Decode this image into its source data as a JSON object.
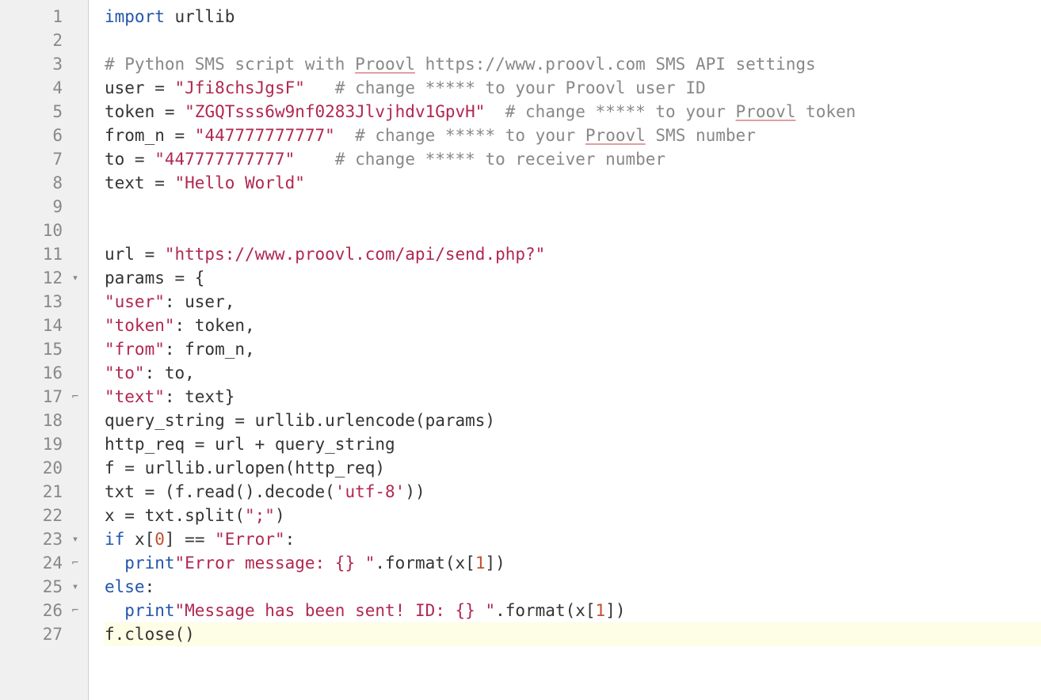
{
  "code": {
    "lines": [
      {
        "n": 1,
        "fold": "",
        "tokens": [
          [
            "kw",
            "import"
          ],
          [
            "",
            " urllib"
          ]
        ]
      },
      {
        "n": 2,
        "fold": "",
        "tokens": []
      },
      {
        "n": 3,
        "fold": "",
        "tokens": [
          [
            "cmt",
            "# Python SMS script with "
          ],
          [
            "cmt typo",
            "Proovl"
          ],
          [
            "cmt",
            " https://www.proovl.com SMS API settings"
          ]
        ]
      },
      {
        "n": 4,
        "fold": "",
        "tokens": [
          [
            "",
            "user = "
          ],
          [
            "str",
            "\"Jfi8chsJgsF\""
          ],
          [
            "",
            "   "
          ],
          [
            "cmt",
            "# change ***** to your Proovl user ID"
          ]
        ]
      },
      {
        "n": 5,
        "fold": "",
        "tokens": [
          [
            "",
            "token = "
          ],
          [
            "str",
            "\"ZGQTsss6w9nf0283Jlvjhdv1GpvH\""
          ],
          [
            "",
            "  "
          ],
          [
            "cmt",
            "# change ***** to your "
          ],
          [
            "cmt typo",
            "Proovl"
          ],
          [
            "cmt",
            " token"
          ]
        ]
      },
      {
        "n": 6,
        "fold": "",
        "tokens": [
          [
            "",
            "from_n = "
          ],
          [
            "str",
            "\"447777777777\""
          ],
          [
            "",
            "  "
          ],
          [
            "cmt",
            "# change ***** to your "
          ],
          [
            "cmt typo",
            "Proovl"
          ],
          [
            "cmt",
            " SMS number"
          ]
        ]
      },
      {
        "n": 7,
        "fold": "",
        "tokens": [
          [
            "",
            "to = "
          ],
          [
            "str",
            "\"447777777777\""
          ],
          [
            "",
            "    "
          ],
          [
            "cmt",
            "# change ***** to receiver number"
          ]
        ]
      },
      {
        "n": 8,
        "fold": "",
        "tokens": [
          [
            "",
            "text = "
          ],
          [
            "str",
            "\"Hello World\""
          ]
        ]
      },
      {
        "n": 9,
        "fold": "",
        "tokens": []
      },
      {
        "n": 10,
        "fold": "",
        "tokens": []
      },
      {
        "n": 11,
        "fold": "",
        "tokens": [
          [
            "",
            "url = "
          ],
          [
            "str",
            "\"https://www.proovl.com/api/send.php?\""
          ]
        ]
      },
      {
        "n": 12,
        "fold": "▾",
        "tokens": [
          [
            "",
            "params = {"
          ]
        ]
      },
      {
        "n": 13,
        "fold": "",
        "tokens": [
          [
            "str",
            "\"user\""
          ],
          [
            "",
            ": user,"
          ]
        ]
      },
      {
        "n": 14,
        "fold": "",
        "tokens": [
          [
            "str",
            "\"token\""
          ],
          [
            "",
            ": token,"
          ]
        ]
      },
      {
        "n": 15,
        "fold": "",
        "tokens": [
          [
            "str",
            "\"from\""
          ],
          [
            "",
            ": from_n,"
          ]
        ]
      },
      {
        "n": 16,
        "fold": "",
        "tokens": [
          [
            "str",
            "\"to\""
          ],
          [
            "",
            ": to,"
          ]
        ]
      },
      {
        "n": 17,
        "fold": "⌐",
        "tokens": [
          [
            "str",
            "\"text\""
          ],
          [
            "",
            ": text}"
          ]
        ]
      },
      {
        "n": 18,
        "fold": "",
        "tokens": [
          [
            "",
            "query_string = urllib.urlencode(params)"
          ]
        ]
      },
      {
        "n": 19,
        "fold": "",
        "tokens": [
          [
            "",
            "http_req = url + query_string"
          ]
        ]
      },
      {
        "n": 20,
        "fold": "",
        "tokens": [
          [
            "",
            "f = urllib.urlopen(http_req)"
          ]
        ]
      },
      {
        "n": 21,
        "fold": "",
        "tokens": [
          [
            "",
            "txt = (f.read().decode("
          ],
          [
            "str",
            "'utf-8'"
          ],
          [
            "",
            "))"
          ]
        ]
      },
      {
        "n": 22,
        "fold": "",
        "tokens": [
          [
            "",
            "x = txt.split("
          ],
          [
            "str",
            "\";\""
          ],
          [
            "",
            ")"
          ]
        ]
      },
      {
        "n": 23,
        "fold": "▾",
        "tokens": [
          [
            "kw",
            "if"
          ],
          [
            "",
            " x["
          ],
          [
            "num",
            "0"
          ],
          [
            "",
            "] == "
          ],
          [
            "str",
            "\"Error\""
          ],
          [
            "",
            ":"
          ]
        ]
      },
      {
        "n": 24,
        "fold": "⌐",
        "tokens": [
          [
            "",
            "  "
          ],
          [
            "fn",
            "print"
          ],
          [
            "str",
            "\"Error message: {} \""
          ],
          [
            "",
            ".format(x["
          ],
          [
            "num",
            "1"
          ],
          [
            "",
            "])"
          ]
        ]
      },
      {
        "n": 25,
        "fold": "▾",
        "tokens": [
          [
            "kw",
            "else"
          ],
          [
            "",
            ":"
          ]
        ]
      },
      {
        "n": 26,
        "fold": "⌐",
        "tokens": [
          [
            "",
            "  "
          ],
          [
            "fn",
            "print"
          ],
          [
            "str",
            "\"Message has been sent! ID: {} \""
          ],
          [
            "",
            ".format(x["
          ],
          [
            "num",
            "1"
          ],
          [
            "",
            "])"
          ]
        ]
      },
      {
        "n": 27,
        "fold": "",
        "current": true,
        "tokens": [
          [
            "",
            "f.close()"
          ]
        ]
      }
    ]
  }
}
